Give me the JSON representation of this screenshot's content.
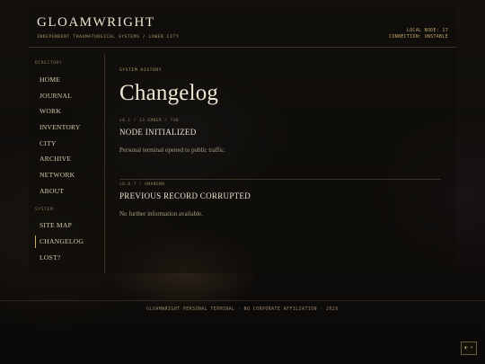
{
  "header": {
    "brand": "GLOAMWRIGHT",
    "tagline": "INDEPENDENT THAUMATURGICAL SYSTEMS / LOWER CITY",
    "status_node": "LOCAL NODE: 17",
    "status_connection": "CONNECTION: UNSTABLE"
  },
  "sidebar": {
    "directory_heading": "DIRECTORY",
    "directory_items": [
      "HOME",
      "JOURNAL",
      "WORK",
      "INVENTORY",
      "CITY",
      "ARCHIVE",
      "NETWORK",
      "ABOUT"
    ],
    "system_heading": "SYSTEM",
    "system_items": [
      "SITE MAP",
      "CHANGELOG",
      "LOST?"
    ],
    "active_item": "CHANGELOG"
  },
  "main": {
    "eyebrow": "SYSTEM HISTORY",
    "title": "Changelog",
    "entries": [
      {
        "meta": "v0.1 / 13 EMBER / 738",
        "title": "NODE INITIALIZED",
        "body": "Personal terminal opened to public traffic."
      },
      {
        "meta": "v0.0.7 / UNKNOWN",
        "title": "PREVIOUS RECORD CORRUPTED",
        "body": "No further information available."
      }
    ]
  },
  "footer": {
    "text": "GLOAMWRIGHT PERSONAL TERMINAL · NO CORPORATE AFFILIATION · 2026"
  },
  "toggle": {
    "label": "◐ ☀"
  },
  "colors": {
    "accent": "#c9a86a",
    "background": "#0d0b09",
    "text": "#d8cdb4"
  }
}
